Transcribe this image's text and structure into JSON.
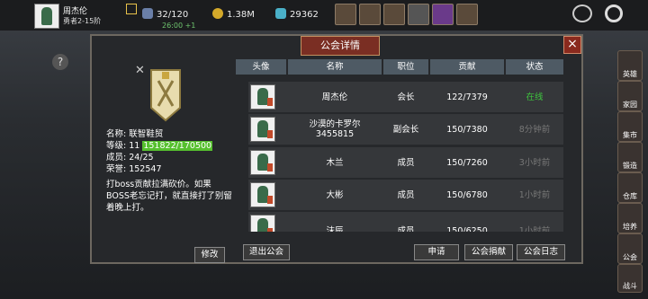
{
  "player": {
    "name": "周杰伦",
    "rank": "勇者2-15阶"
  },
  "resources": {
    "stamina": "32/120",
    "gold": "1.38M",
    "gems": "29362",
    "timer": "26:00 +1"
  },
  "panel": {
    "title": "公会详情",
    "close": "×"
  },
  "guild": {
    "name_line": "名称: 联智鞋贸",
    "level_label": "等级: 11",
    "level_progress": "151822/170500",
    "level_fraction": 0.89,
    "members_line": "成员: 24/25",
    "honor_line": "荣誉: 152547",
    "notice": "打boss贡献拉满砍价。如果BOSS老忘记打，就直接打了别留着晚上打。",
    "edit_label": "修改",
    "leave_label": "退出公会"
  },
  "table": {
    "headers": [
      "头像",
      "名称",
      "职位",
      "贡献",
      "状态"
    ],
    "rows": [
      {
        "name": "周杰伦",
        "role": "会长",
        "contrib": "122/7379",
        "status": "在线"
      },
      {
        "name": "沙漠的卡罗尔\n3455815",
        "role": "副会长",
        "contrib": "150/7380",
        "status": "8分钟前"
      },
      {
        "name": "木兰",
        "role": "成员",
        "contrib": "150/7260",
        "status": "3小时前"
      },
      {
        "name": "大彬",
        "role": "成员",
        "contrib": "150/6780",
        "status": "1小时前"
      },
      {
        "name": "沫辰",
        "role": "成员",
        "contrib": "150/6250",
        "status": "1小时前"
      }
    ]
  },
  "actions": {
    "apply": "申请",
    "donate": "公会捐献",
    "log": "公会日志"
  },
  "sidebar": [
    "英雄",
    "家园",
    "集市",
    "锻造",
    "仓库",
    "培养",
    "公会",
    "战斗"
  ],
  "colors": {
    "online": "#3ec43e",
    "level_bar": "#56c02e",
    "title_bg": "#7a2e23"
  }
}
